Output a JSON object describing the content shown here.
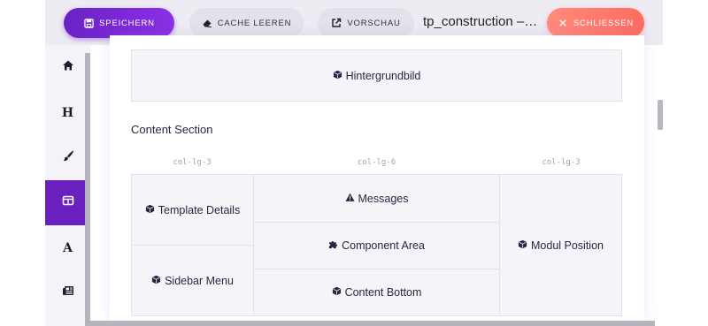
{
  "toolbar": {
    "save_label": "SPEICHERN",
    "cache_label": "CACHE LEEREN",
    "preview_label": "VORSCHAU",
    "title": "tp_construction – St...",
    "close_label": "SCHLIESSEN"
  },
  "sidebar": {
    "items": [
      {
        "icon": "home-icon"
      },
      {
        "icon": "heading-icon",
        "glyph": "H"
      },
      {
        "icon": "paintbrush-icon"
      },
      {
        "icon": "layout-icon",
        "active": true
      },
      {
        "icon": "font-icon",
        "glyph": "A"
      },
      {
        "icon": "newspaper-icon"
      }
    ]
  },
  "layout": {
    "top_box": "Hintergrundbild",
    "section_title": "Content Section",
    "columns": [
      "col-lg-3",
      "col-lg-6",
      "col-lg-3"
    ],
    "left_boxes": [
      "Template Details",
      "Sidebar Menu"
    ],
    "center_boxes": [
      "Messages",
      "Component Area",
      "Content Bottom"
    ],
    "right_box": "Modul Position"
  },
  "colors": {
    "accent_purple": "#6a1fbf",
    "close_coral": "#ff7a6e"
  }
}
